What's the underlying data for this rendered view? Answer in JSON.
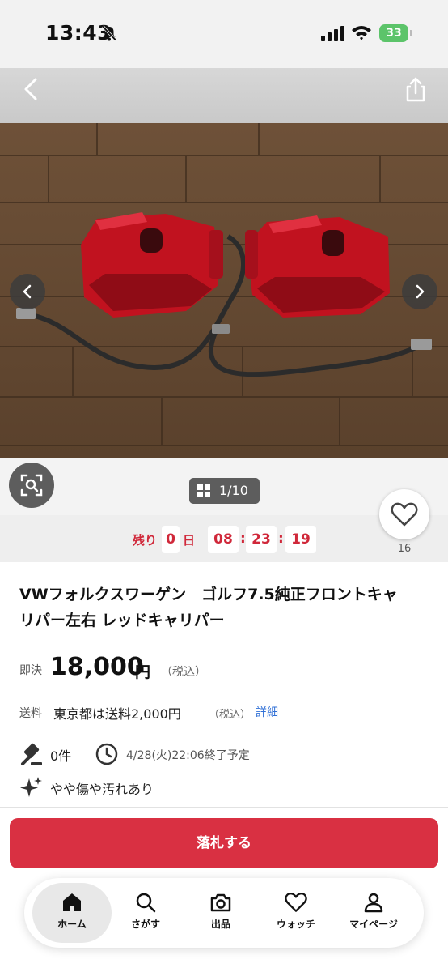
{
  "status_bar": {
    "time": "13:43",
    "battery": "33",
    "accent": "#5cc46a"
  },
  "nav": {
    "back_icon": "chevron-left-icon",
    "share_icon": "share-icon"
  },
  "photo": {
    "counter": "1/10",
    "prev_icon": "chevron-left-icon",
    "next_icon": "chevron-right-icon",
    "lens_icon": "image-search-icon"
  },
  "countdown": {
    "label": "残り",
    "days": "0",
    "days_unit": "日",
    "hours": "08",
    "minutes": "23",
    "seconds": "19",
    "color": "#d0283a"
  },
  "watch": {
    "count": "16"
  },
  "item": {
    "title": "VWフォルクスワーゲン　ゴルフ7.5純正フロントキャリパー左右 レッドキャリパー",
    "price_label": "即決",
    "price": "18,000",
    "price_unit": "円",
    "price_tax": "（税込）",
    "shipping_label": "送料",
    "shipping_text": "東京都は送料2,000円",
    "shipping_tax": "（税込）",
    "shipping_detail": "詳細",
    "bids": "0件",
    "end_time": "4/28(火)22:06終了予定",
    "condition": "やや傷や汚れあり"
  },
  "bid_button": {
    "label": "落札する",
    "color": "#d93042"
  },
  "tabbar": {
    "items": [
      {
        "label": "ホーム",
        "icon": "home-icon"
      },
      {
        "label": "さがす",
        "icon": "search-icon"
      },
      {
        "label": "出品",
        "icon": "camera-icon"
      },
      {
        "label": "ウォッチ",
        "icon": "heart-icon"
      },
      {
        "label": "マイページ",
        "icon": "person-icon"
      }
    ]
  }
}
